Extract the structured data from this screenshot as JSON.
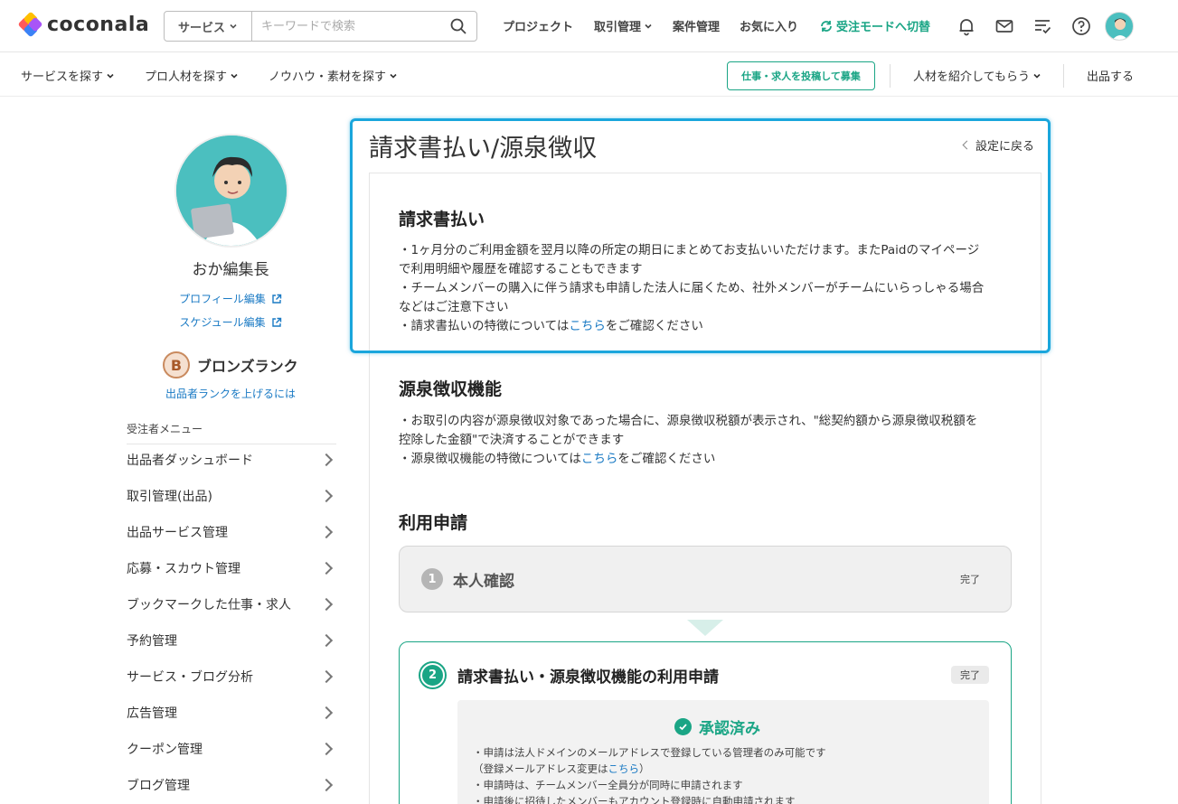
{
  "header": {
    "logo_text": "coconala",
    "search_category": "サービス",
    "search_placeholder": "キーワードで検索",
    "nav": {
      "project": "プロジェクト",
      "transactions": "取引管理",
      "cases": "案件管理",
      "favorites": "お気に入り",
      "mode_switch": "受注モードへ切替"
    }
  },
  "subnav": {
    "find_service": "サービスを探す",
    "find_pro": "プロ人材を探す",
    "knowhow": "ノウハウ・素材を探す",
    "post_job": "仕事・求人を投稿して募集",
    "referral": "人材を紹介してもらう",
    "sell": "出品する"
  },
  "sidebar": {
    "user_name": "おか編集長",
    "profile_edit": "プロフィール編集",
    "schedule_edit": "スケジュール編集",
    "rank_badge": "B",
    "rank_name": "ブロンズランク",
    "rank_up": "出品者ランクを上げるには",
    "menu_title": "受注者メニュー",
    "menu_items": [
      "出品者ダッシュボード",
      "取引管理(出品)",
      "出品サービス管理",
      "応募・スカウト管理",
      "ブックマークした仕事・求人",
      "予約管理",
      "サービス・ブログ分析",
      "広告管理",
      "クーポン管理",
      "ブログ管理"
    ]
  },
  "main": {
    "title": "請求書払い/源泉徴収",
    "back": "設定に戻る",
    "invoice": {
      "heading": "請求書払い",
      "line1": "・1ヶ月分のご利用金額を翌月以降の所定の期日にまとめてお支払いいただけます。またPaidのマイページ",
      "line2": "で利用明細や履歴を確認することもできます",
      "line3": "・チームメンバーの購入に伴う請求も申請した法人に届くため、社外メンバーがチームにいらっしゃる場合",
      "line4": "などはご注意下さい",
      "line5_pre": "・請求書払いの特徴については",
      "line5_link": "こちら",
      "line5_post": "をご確認ください"
    },
    "withholding": {
      "heading": "源泉徴収機能",
      "line1": "・お取引の内容が源泉徴収対象であった場合に、源泉徴収税額が表示され、\"総契約額から源泉徴収税額を",
      "line2": "控除した金額\"で決済することができます",
      "line3_pre": "・源泉徴収機能の特徴については",
      "line3_link": "こちら",
      "line3_post": "をご確認ください"
    },
    "application": {
      "heading": "利用申請",
      "step1": {
        "num": "1",
        "title": "本人確認",
        "status": "完了"
      },
      "step2": {
        "num": "2",
        "title": "請求書払い・源泉徴収機能の利用申請",
        "status": "完了"
      },
      "approved": "承認済み",
      "notes": {
        "n1": "・申請は法人ドメインのメールアドレスで登録している管理者のみ可能です",
        "n2_pre": "（登録メールアドレス変更は",
        "n2_link": "こちら",
        "n2_post": "）",
        "n3": "・申請時は、チームメンバー全員分が同時に申請されます",
        "n4": "・申請後に招待したメンバーもアカウント登録時に自動申請されます"
      }
    }
  },
  "colors": {
    "accent": "#1aa585",
    "link": "#1a7ac4",
    "highlight": "#1aa6dc"
  }
}
